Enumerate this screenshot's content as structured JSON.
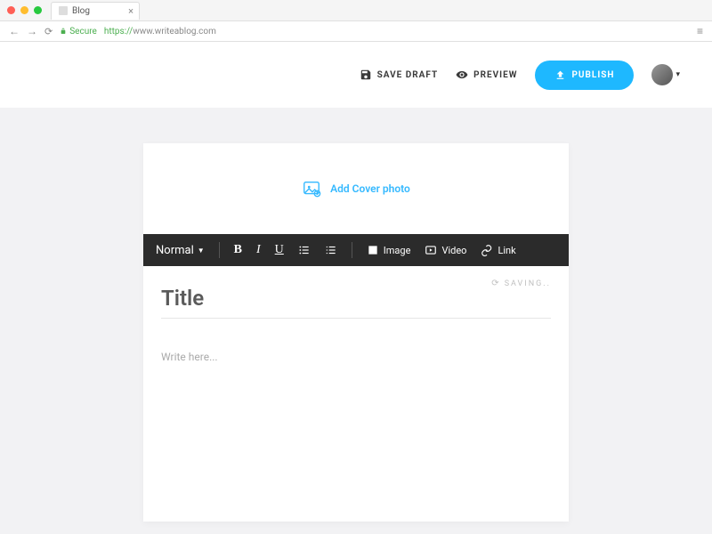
{
  "browser": {
    "tab_title": "Blog",
    "secure_label": "Secure",
    "url_protocol": "https://",
    "url_rest": "www.writeablog.com"
  },
  "header": {
    "save_draft_label": "SAVE DRAFT",
    "preview_label": "PREVIEW",
    "publish_label": "PUBLISH"
  },
  "editor": {
    "cover_label": "Add Cover photo",
    "format_selector": "Normal",
    "toolbar": {
      "bold": "B",
      "italic": "I",
      "underline": "U",
      "image": "Image",
      "video": "Video",
      "link": "Link"
    },
    "saving_label": "SAVING..",
    "title_placeholder": "Title",
    "body_placeholder": "Write here..."
  },
  "colors": {
    "accent": "#1eb8ff",
    "toolbar_bg": "#2b2b2b"
  }
}
